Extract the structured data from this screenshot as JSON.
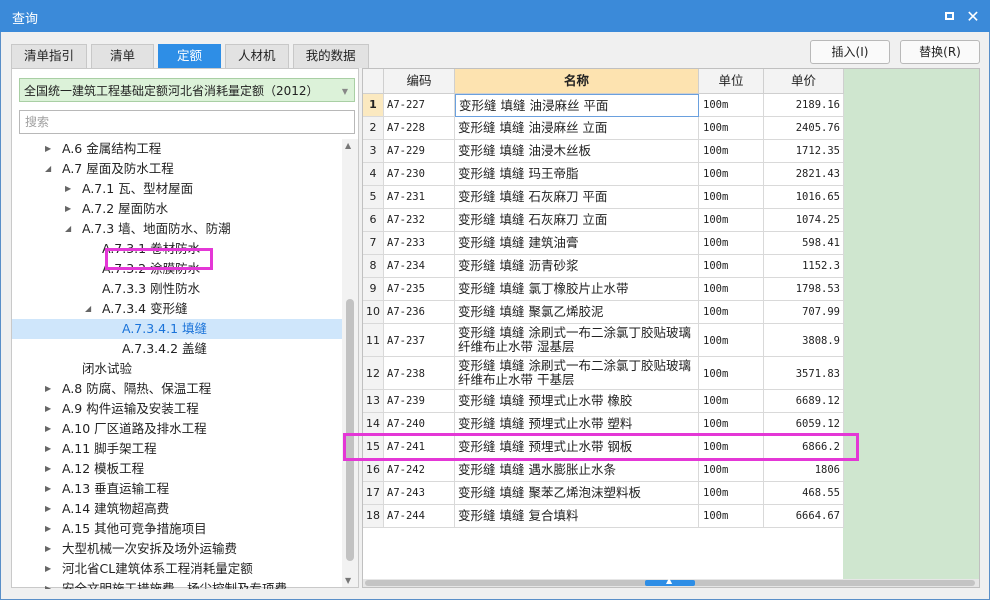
{
  "window": {
    "title": "查询",
    "max_glyph": "",
    "close_glyph": "✕"
  },
  "tabs": [
    {
      "label": "清单指引"
    },
    {
      "label": "清单"
    },
    {
      "label": "定额",
      "active": true
    },
    {
      "label": "人材机"
    },
    {
      "label": "我的数据"
    }
  ],
  "actions": {
    "insert": "插入(I)",
    "replace": "替换(R)"
  },
  "library": {
    "selected": "全国统一建筑工程基础定额河北省消耗量定额（2012）"
  },
  "search": {
    "placeholder": "搜索"
  },
  "tree": [
    {
      "label": "A.6 金属结构工程",
      "arrow": "▶"
    },
    {
      "label": "A.7 屋面及防水工程",
      "arrow": "◢"
    },
    {
      "label": "A.7.1 瓦、型材屋面",
      "arrow": "▶"
    },
    {
      "label": "A.7.2 屋面防水",
      "arrow": "▶"
    },
    {
      "label": "A.7.3 墙、地面防水、防潮",
      "arrow": "◢"
    },
    {
      "label": "A.7.3.1 卷材防水",
      "arrow": ""
    },
    {
      "label": "A.7.3.2 涂膜防水",
      "arrow": ""
    },
    {
      "label": "A.7.3.3 刚性防水",
      "arrow": ""
    },
    {
      "label": "A.7.3.4 变形缝",
      "arrow": "◢"
    },
    {
      "label": "A.7.3.4.1 填缝",
      "arrow": ""
    },
    {
      "label": "A.7.3.4.2 盖缝",
      "arrow": ""
    },
    {
      "label": "闭水试验",
      "arrow": ""
    },
    {
      "label": "A.8 防腐、隔热、保温工程",
      "arrow": "▶"
    },
    {
      "label": "A.9 构件运输及安装工程",
      "arrow": "▶"
    },
    {
      "label": "A.10 厂区道路及排水工程",
      "arrow": "▶"
    },
    {
      "label": "A.11 脚手架工程",
      "arrow": "▶"
    },
    {
      "label": "A.12 模板工程",
      "arrow": "▶"
    },
    {
      "label": "A.13 垂直运输工程",
      "arrow": "▶"
    },
    {
      "label": "A.14 建筑物超高费",
      "arrow": "▶"
    },
    {
      "label": "A.15 其他可竞争措施项目",
      "arrow": "▶"
    },
    {
      "label": "大型机械一次安拆及场外运输费",
      "arrow": "▶"
    },
    {
      "label": "河北省CL建筑体系工程消耗量定额",
      "arrow": "▶"
    },
    {
      "label": "安全文明施工措施费、扬尘控制及专项费",
      "arrow": "▶"
    }
  ],
  "scroll": {
    "up": "▲",
    "down": "▼",
    "split": "▲"
  },
  "table": {
    "headers": {
      "index": "",
      "code": "编码",
      "name": "名称",
      "unit": "单位",
      "price": "单价"
    },
    "rows": [
      {
        "idx": "1",
        "code": "A7-227",
        "name": "变形缝 填缝 油浸麻丝 平面",
        "unit": "100m",
        "price": "2189.16"
      },
      {
        "idx": "2",
        "code": "A7-228",
        "name": "变形缝 填缝 油浸麻丝 立面",
        "unit": "100m",
        "price": "2405.76"
      },
      {
        "idx": "3",
        "code": "A7-229",
        "name": "变形缝 填缝 油浸木丝板",
        "unit": "100m",
        "price": "1712.35"
      },
      {
        "idx": "4",
        "code": "A7-230",
        "name": "变形缝 填缝 玛王帝脂",
        "unit": "100m",
        "price": "2821.43"
      },
      {
        "idx": "5",
        "code": "A7-231",
        "name": "变形缝 填缝 石灰麻刀 平面",
        "unit": "100m",
        "price": "1016.65"
      },
      {
        "idx": "6",
        "code": "A7-232",
        "name": "变形缝 填缝 石灰麻刀 立面",
        "unit": "100m",
        "price": "1074.25"
      },
      {
        "idx": "7",
        "code": "A7-233",
        "name": "变形缝 填缝 建筑油膏",
        "unit": "100m",
        "price": "598.41"
      },
      {
        "idx": "8",
        "code": "A7-234",
        "name": "变形缝 填缝 沥青砂浆",
        "unit": "100m",
        "price": "1152.3"
      },
      {
        "idx": "9",
        "code": "A7-235",
        "name": "变形缝 填缝 氯丁橡胶片止水带",
        "unit": "100m",
        "price": "1798.53"
      },
      {
        "idx": "10",
        "code": "A7-236",
        "name": "变形缝 填缝 聚氯乙烯胶泥",
        "unit": "100m",
        "price": "707.99"
      },
      {
        "idx": "11",
        "code": "A7-237",
        "name": "变形缝 填缝 涂刷式一布二涂氯丁胶贴玻璃纤维布止水带 湿基层",
        "unit": "100m",
        "price": "3808.9"
      },
      {
        "idx": "12",
        "code": "A7-238",
        "name": "变形缝 填缝 涂刷式一布二涂氯丁胶贴玻璃纤维布止水带 干基层",
        "unit": "100m",
        "price": "3571.83"
      },
      {
        "idx": "13",
        "code": "A7-239",
        "name": "变形缝 填缝 预埋式止水带 橡胶",
        "unit": "100m",
        "price": "6689.12"
      },
      {
        "idx": "14",
        "code": "A7-240",
        "name": "变形缝 填缝 预埋式止水带 塑料",
        "unit": "100m",
        "price": "6059.12"
      },
      {
        "idx": "15",
        "code": "A7-241",
        "name": "变形缝 填缝 预埋式止水带 钢板",
        "unit": "100m",
        "price": "6866.2"
      },
      {
        "idx": "16",
        "code": "A7-242",
        "name": "变形缝 填缝 遇水膨胀止水条",
        "unit": "100m",
        "price": "1806"
      },
      {
        "idx": "17",
        "code": "A7-243",
        "name": "变形缝 填缝 聚苯乙烯泡沫塑料板",
        "unit": "100m",
        "price": "468.55"
      },
      {
        "idx": "18",
        "code": "A7-244",
        "name": "变形缝 填缝 复合填料",
        "unit": "100m",
        "price": "6664.67"
      }
    ]
  }
}
